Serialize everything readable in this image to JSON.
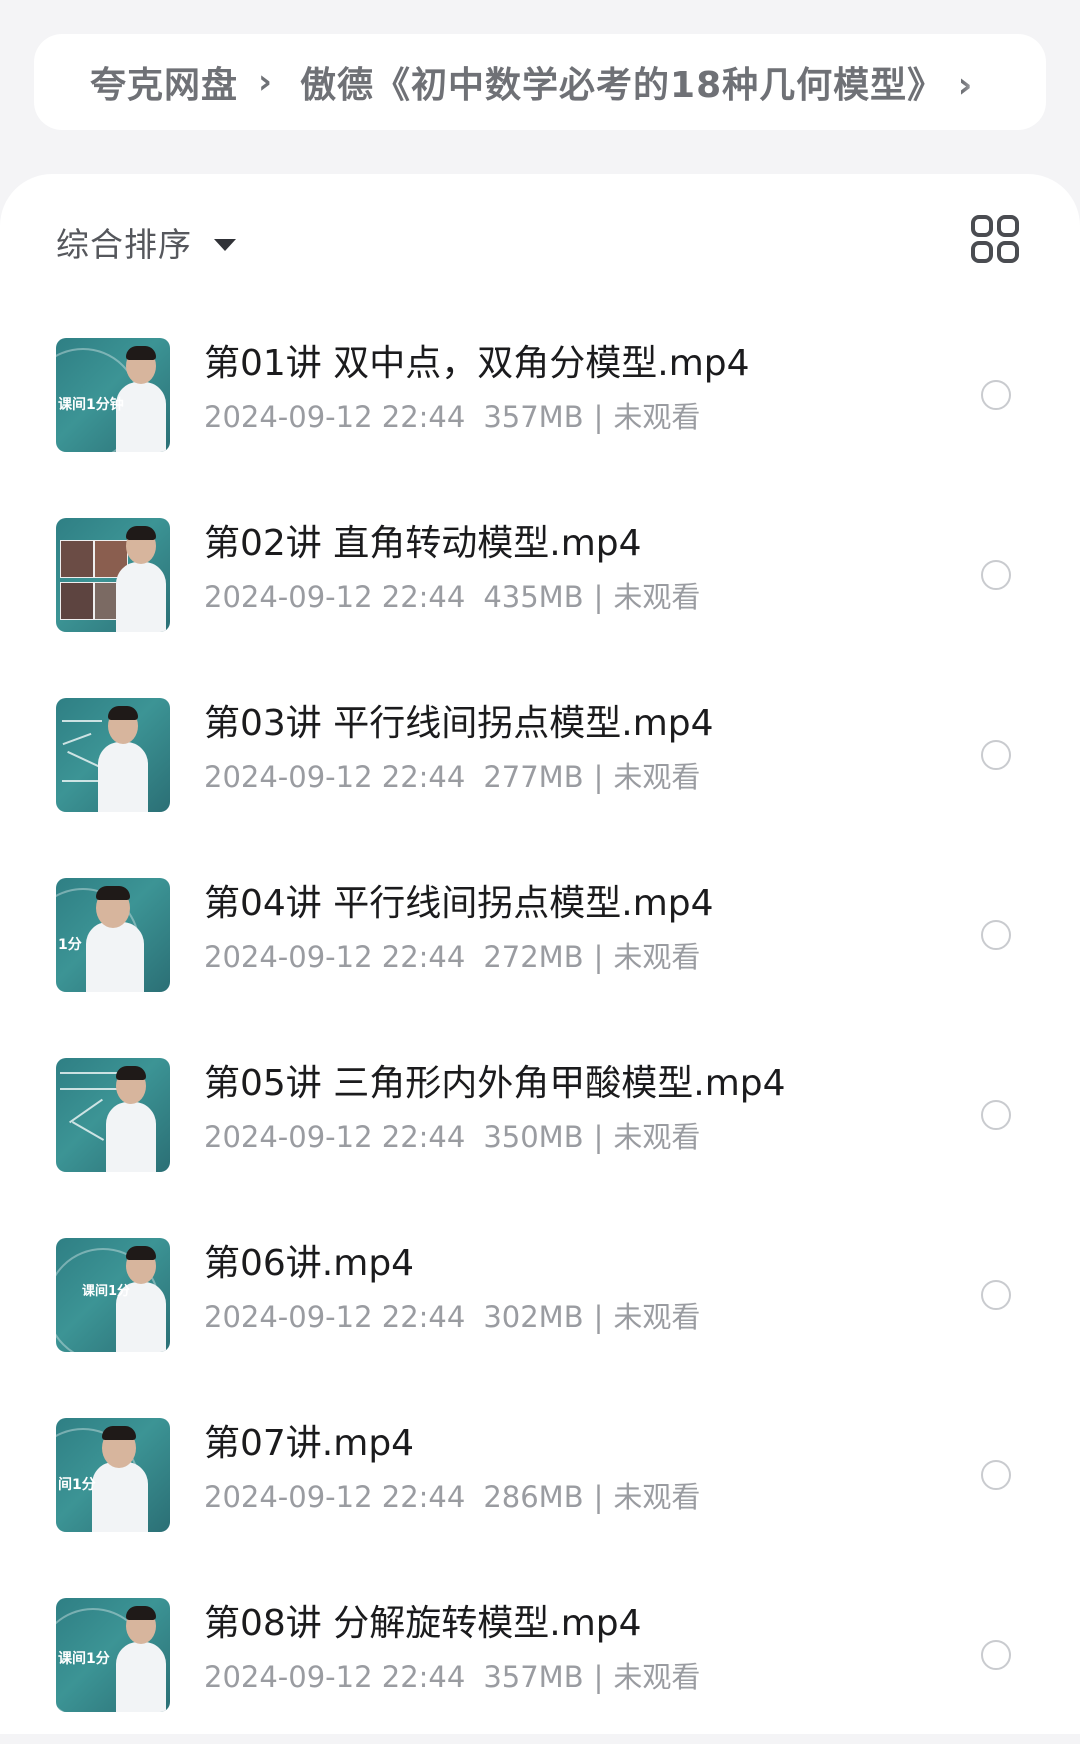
{
  "breadcrumb": {
    "root": "夸克网盘",
    "separator": "›",
    "current": "傲德《初中数学必考的18种几何模型》 ›"
  },
  "toolbar": {
    "sort_label": "综合排序",
    "sort_caret_icon": "caret-down-icon",
    "view_toggle_icon": "grid-view-icon"
  },
  "files": [
    {
      "name": "第01讲 双中点，双角分模型.mp4",
      "date": "2024-09-12 22:44",
      "size": "357MB",
      "separator": "|",
      "status": "未观看",
      "thumb_caption": "课间1分钟"
    },
    {
      "name": "第02讲 直角转动模型.mp4",
      "date": "2024-09-12 22:44",
      "size": "435MB",
      "separator": "|",
      "status": "未观看",
      "thumb_caption": ""
    },
    {
      "name": "第03讲 平行线间拐点模型.mp4",
      "date": "2024-09-12 22:44",
      "size": "277MB",
      "separator": "|",
      "status": "未观看",
      "thumb_caption": ""
    },
    {
      "name": "第04讲 平行线间拐点模型.mp4",
      "date": "2024-09-12 22:44",
      "size": "272MB",
      "separator": "|",
      "status": "未观看",
      "thumb_caption": "1分"
    },
    {
      "name": "第05讲 三角形内外角甲酸模型.mp4",
      "date": "2024-09-12 22:44",
      "size": "350MB",
      "separator": "|",
      "status": "未观看",
      "thumb_caption": ""
    },
    {
      "name": "第06讲.mp4",
      "date": "2024-09-12 22:44",
      "size": "302MB",
      "separator": "|",
      "status": "未观看",
      "thumb_caption": "课间1分"
    },
    {
      "name": "第07讲.mp4",
      "date": "2024-09-12 22:44",
      "size": "286MB",
      "separator": "|",
      "status": "未观看",
      "thumb_caption": "间1分"
    },
    {
      "name": "第08讲 分解旋转模型.mp4",
      "date": "2024-09-12 22:44",
      "size": "357MB",
      "separator": "|",
      "status": "未观看",
      "thumb_caption": "课间1分"
    }
  ],
  "colors": {
    "page_background": "#f4f4f6",
    "card_background": "#ffffff",
    "title_text": "#1b1b1d",
    "meta_text": "#9a9ca1",
    "thumb_teal": "#2f7f84"
  }
}
